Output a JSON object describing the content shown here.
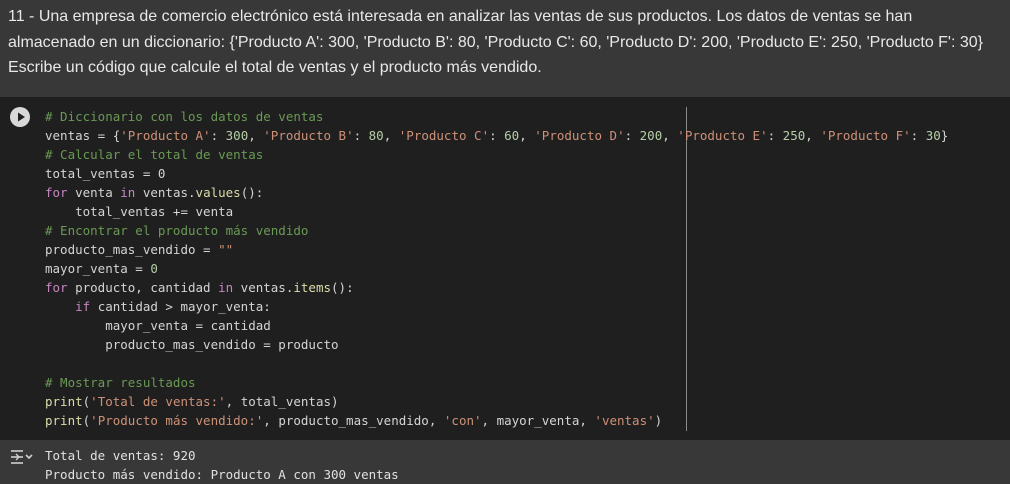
{
  "text_cell": {
    "question": "11 - Una empresa de comercio electrónico está interesada en analizar las ventas de sus productos. Los datos de ventas se han almacenado en un diccionario: {'Producto A': 300, 'Producto B': 80, 'Producto C': 60, 'Producto D': 200, 'Producto E': 250, 'Producto F': 30} Escribe un código que calcule el total de ventas y el producto más vendido."
  },
  "code_cell": {
    "run_icon": "play-circle-icon",
    "line1": "# Diccionario con los datos de ventas",
    "line2": {
      "var": "ventas",
      "op": " = {",
      "kA": "'Producto A'",
      "vA": "300",
      "kB": "'Producto B'",
      "vB": "80",
      "kC": "'Producto C'",
      "vC": "60",
      "kD": "'Producto D'",
      "vD": "200",
      "kE": "'Producto E'",
      "vE": "250",
      "kF": "'Producto F'",
      "vF": "30"
    },
    "line3": "# Calcular el total de ventas",
    "line4": "total_ventas = 0",
    "line5": {
      "kw1": "for",
      "a": " venta ",
      "kw2": "in",
      "b": " ventas.",
      "fn": "values",
      "c": "():"
    },
    "line6": "    total_ventas += venta",
    "line7": "# Encontrar el producto más vendido",
    "line8": {
      "a": "producto_mas_vendido = ",
      "s": "\"\""
    },
    "line9": {
      "a": "mayor_venta = ",
      "n": "0"
    },
    "line10": {
      "kw1": "for",
      "a": " producto, cantidad ",
      "kw2": "in",
      "b": " ventas.",
      "fn": "items",
      "c": "():"
    },
    "line11": {
      "indent": "    ",
      "kw": "if",
      "a": " cantidad > mayor_venta:"
    },
    "line12": "        mayor_venta = cantidad",
    "line13": "        producto_mas_vendido = producto",
    "line15": "# Mostrar resultados",
    "line16": {
      "fn": "print",
      "a": "(",
      "s": "'Total de ventas:'",
      "b": ", total_ventas)"
    },
    "line17": {
      "fn": "print",
      "a": "(",
      "s1": "'Producto más vendido:'",
      "b": ", producto_mas_vendido, ",
      "s2": "'con'",
      "c": ", mayor_venta, ",
      "s3": "'ventas'",
      "d": ")"
    }
  },
  "output": {
    "icon": "output-toggle-icon",
    "line1": "Total de ventas: 920",
    "line2": "Producto más vendido: Producto A con 300 ventas"
  },
  "colors": {
    "background": "#383838",
    "code_background": "#1f1f1f",
    "comment": "#6a9955",
    "string": "#ce9178",
    "number": "#b5cea8",
    "keyword": "#569cd6",
    "function": "#dcdcaa"
  }
}
